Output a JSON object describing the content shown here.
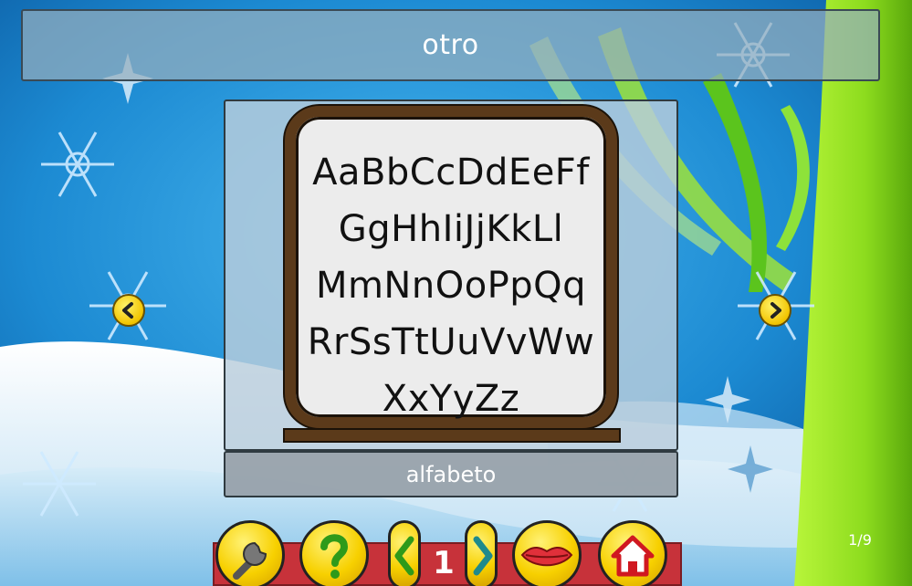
{
  "header": {
    "title": "otro"
  },
  "card": {
    "caption": "alfabeto",
    "board_lines": [
      "AaBbCcDdEeFf",
      "GgHhIiJjKkLl",
      "MmNnOoPpQq",
      "RrSsTtUuVvWw",
      "XxYyZz"
    ]
  },
  "navigation": {
    "prev_icon": "chevron-left-icon",
    "next_icon": "chevron-right-icon"
  },
  "toolbar": {
    "page_number": "1",
    "buttons": [
      "wrench-icon",
      "question-icon",
      "chevron-left-icon",
      "chevron-right-icon",
      "lips-icon",
      "home-icon"
    ]
  },
  "counter": "1/9",
  "colors": {
    "sky": "#1a8fd6",
    "snow": "#e8f3fb",
    "toolbar": "#c7323a",
    "button": "#f7d000",
    "stem": "#8ddc1e"
  }
}
